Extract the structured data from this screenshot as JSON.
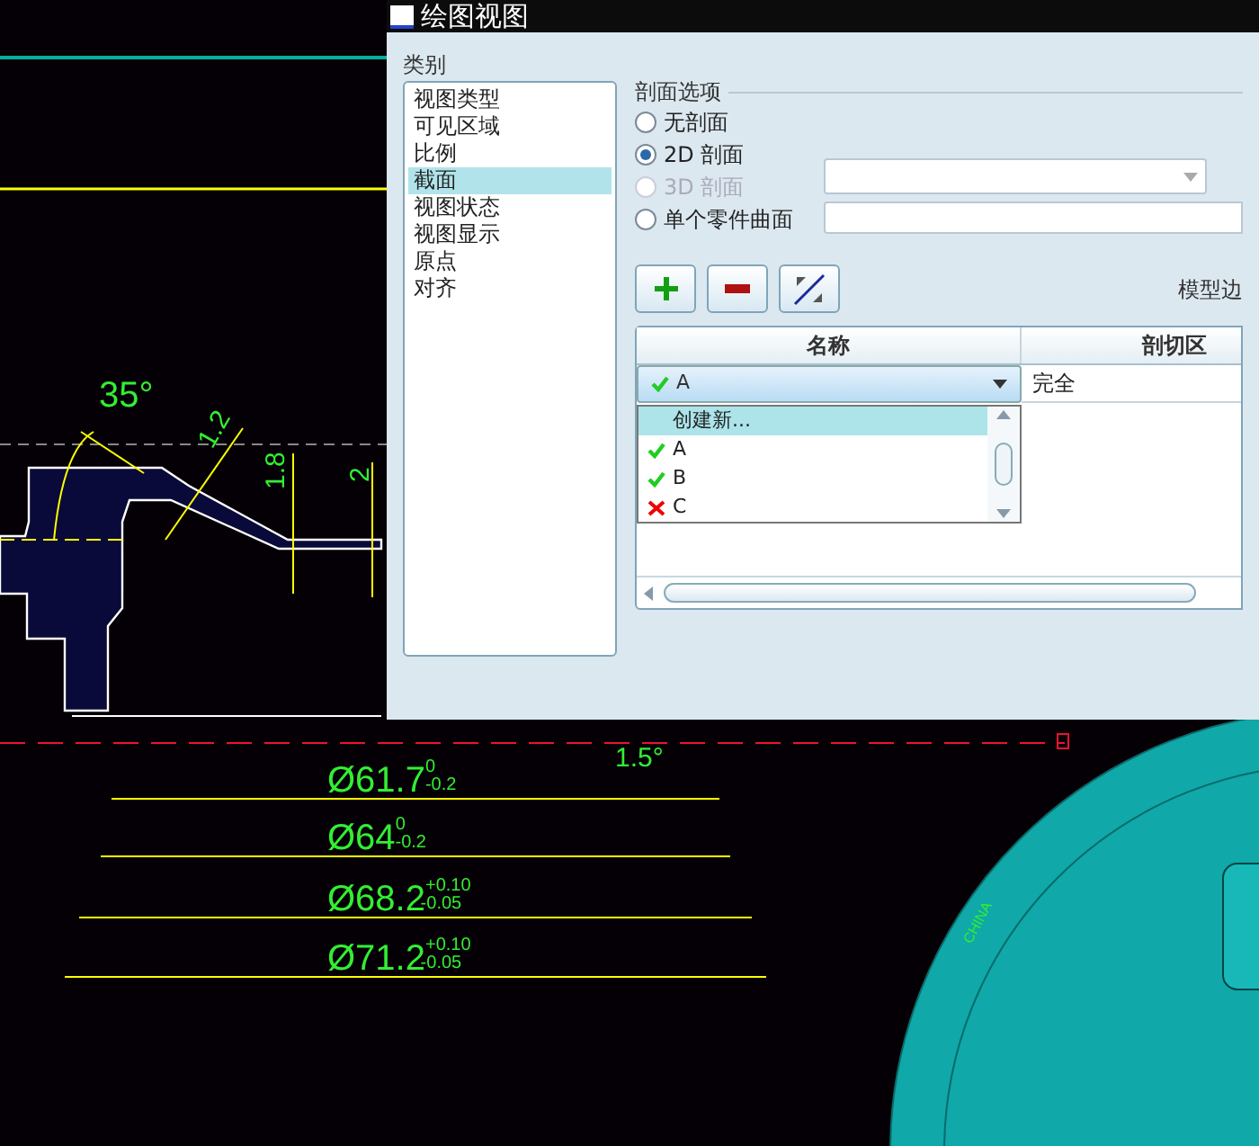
{
  "drawing": {
    "angles": [
      {
        "text": "35°",
        "kind": "large"
      },
      {
        "text": "1.5°",
        "kind": "small"
      }
    ],
    "small_dims": [
      "1.2",
      "1.8",
      "2"
    ],
    "diameters": [
      {
        "value": "Ø61.7",
        "upper": "0",
        "lower": "-0.2"
      },
      {
        "value": "Ø64",
        "upper": "0",
        "lower": "-0.2"
      },
      {
        "value": "Ø68.2",
        "upper": "+0.10",
        "lower": "-0.05"
      },
      {
        "value": "Ø71.2",
        "upper": "+0.10",
        "lower": "-0.05"
      }
    ],
    "model_text": "CHINA"
  },
  "dialog": {
    "title": "绘图视图",
    "category_label": "类别",
    "categories": [
      {
        "label": "视图类型",
        "selected": false
      },
      {
        "label": "可见区域",
        "selected": false
      },
      {
        "label": "比例",
        "selected": false
      },
      {
        "label": "截面",
        "selected": true
      },
      {
        "label": "视图状态",
        "selected": false
      },
      {
        "label": "视图显示",
        "selected": false
      },
      {
        "label": "原点",
        "selected": false
      },
      {
        "label": "对齐",
        "selected": false
      }
    ],
    "group_label": "剖面选项",
    "options": [
      {
        "label": "无剖面",
        "selected": false,
        "disabled": false
      },
      {
        "label": "2D 剖面",
        "selected": true,
        "disabled": false
      },
      {
        "label": "3D 剖面",
        "selected": false,
        "disabled": true
      },
      {
        "label": "单个零件曲面",
        "selected": false,
        "disabled": false
      }
    ],
    "model_edge_label": "模型边",
    "table": {
      "columns": [
        "名称",
        "剖切区"
      ],
      "rows": [
        {
          "name": "A",
          "kind": "valid",
          "region": "完全"
        }
      ]
    },
    "dropdown": [
      {
        "label": "创建新...",
        "kind": "plain",
        "selected": true
      },
      {
        "label": "A",
        "kind": "valid",
        "selected": false
      },
      {
        "label": "B",
        "kind": "valid",
        "selected": false
      },
      {
        "label": "C",
        "kind": "invalid",
        "selected": false
      }
    ]
  }
}
